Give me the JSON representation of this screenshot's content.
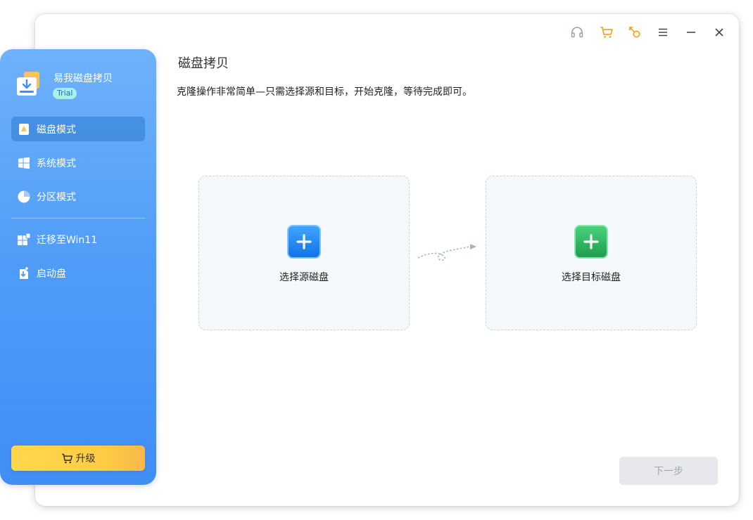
{
  "app": {
    "name": "易我磁盘拷贝",
    "badge": "Trial"
  },
  "sidebar": {
    "items": [
      {
        "label": "磁盘模式",
        "icon": "disk-mode-icon",
        "active": true
      },
      {
        "label": "系统模式",
        "icon": "windows-icon",
        "active": false
      },
      {
        "label": "分区模式",
        "icon": "pie-chart-icon",
        "active": false
      },
      {
        "label": "迁移至Win11",
        "icon": "win11-migrate-icon",
        "active": false
      },
      {
        "label": "启动盘",
        "icon": "boot-disk-icon",
        "active": false
      }
    ],
    "upgrade_label": "升级"
  },
  "topbar": {
    "icons": [
      "headset-icon",
      "cart-icon",
      "key-icon",
      "menu-icon",
      "minimize-icon",
      "close-icon"
    ]
  },
  "main": {
    "title": "磁盘拷贝",
    "description": "克隆操作非常简单—只需选择源和目标，开始克隆，等待完成即可。",
    "source_label": "选择源磁盘",
    "target_label": "选择目标磁盘",
    "next_label": "下一步"
  },
  "colors": {
    "accent_blue": "#1173e6",
    "accent_green": "#1f9e4f",
    "icon_orange": "#f5a623",
    "upgrade_yellow": "#ffd84d"
  }
}
